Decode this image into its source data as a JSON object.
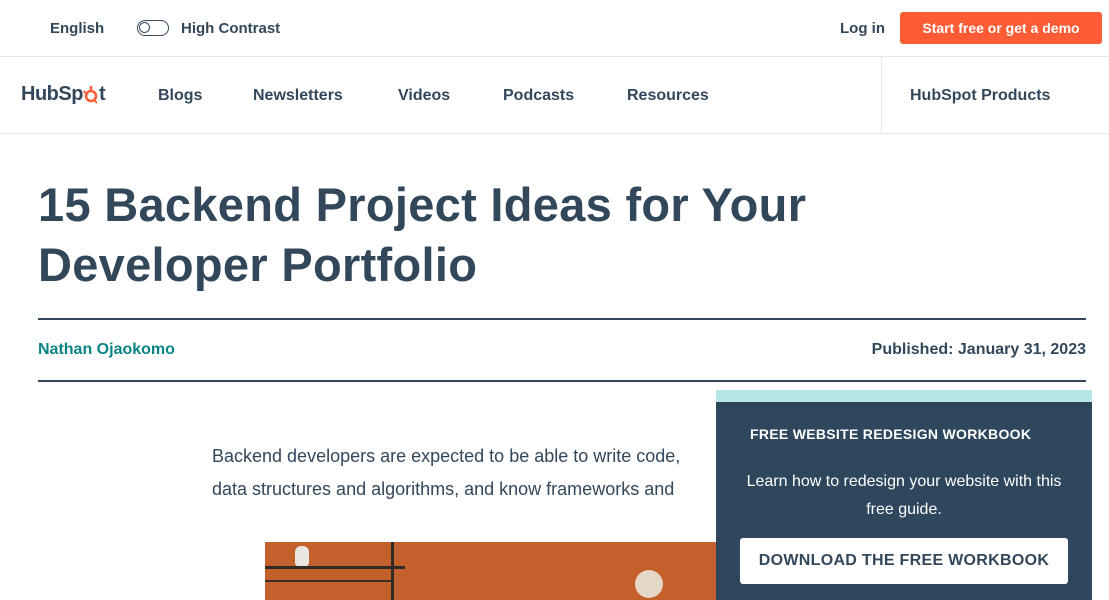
{
  "utility": {
    "language": "English",
    "high_contrast_label": "High Contrast",
    "login": "Log in",
    "cta": "Start free or get a demo"
  },
  "nav": {
    "logo_left": "HubSp",
    "logo_right": "t",
    "items": [
      "Blogs",
      "Newsletters",
      "Videos",
      "Podcasts",
      "Resources"
    ],
    "products": "HubSpot Products"
  },
  "article": {
    "title": "15 Backend Project Ideas for Your Developer Portfolio",
    "author": "Nathan Ojaokomo",
    "published": "Published: January 31, 2023",
    "intro_line1": "Backend developers are expected to be able to write code,",
    "intro_line2": "data structures and algorithms, and know frameworks and"
  },
  "popup": {
    "heading": "FREE WEBSITE REDESIGN WORKBOOK",
    "description": "Learn how to redesign your website with this free guide.",
    "button": "DOWNLOAD THE FREE WORKBOOK"
  },
  "colors": {
    "brand_orange": "#ff5c35",
    "text_dark": "#33475b",
    "author_teal": "#0b8484",
    "popup_bg": "#2e475d",
    "popup_stripe": "#b7e6e6"
  }
}
